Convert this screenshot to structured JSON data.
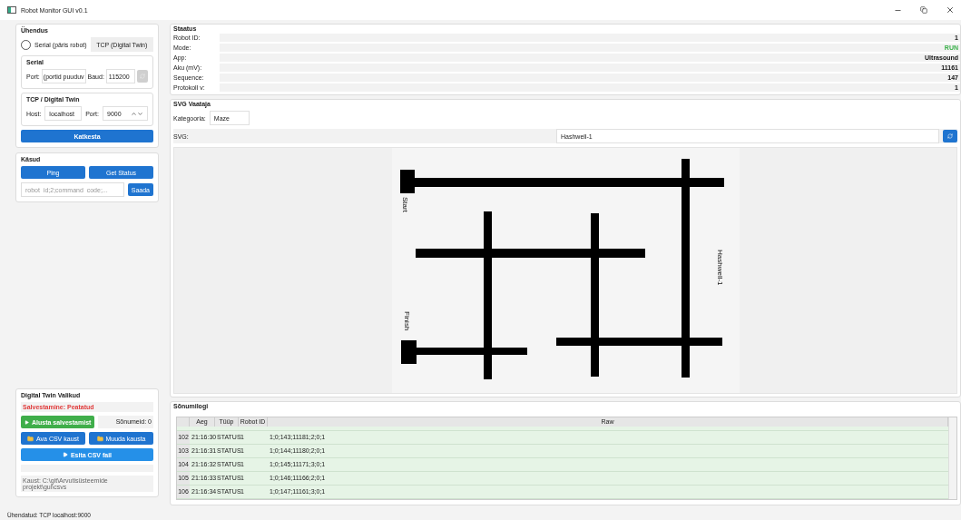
{
  "window": {
    "title": "Robot Monitor GUI v0.1"
  },
  "connection": {
    "title": "Ühendus",
    "modes": [
      {
        "label": "Serial (päris robot)",
        "selected": false
      },
      {
        "label": "TCP (Digital Twin)",
        "selected": true
      }
    ],
    "serial": {
      "title": "Serial",
      "port_label": "Port:",
      "port_value": "(portid puuduv",
      "baud_label": "Baud:",
      "baud_value": "115200",
      "refresh_disabled": true
    },
    "tcp": {
      "title": "TCP / Digital Twin",
      "host_label": "Host:",
      "host_value": "localhost",
      "port_label": "Port:",
      "port_value": "9000"
    },
    "disconnect_button": "Katkesta"
  },
  "commands": {
    "title": "Käsud",
    "buttons": [
      "Ping",
      "Get Status"
    ],
    "input": {
      "placeholder": "robot_id;2;command_code;..."
    },
    "send_button": "Saada"
  },
  "digital_twin": {
    "title": "Digital Twin Valikud",
    "recording_status": "Salvestamine: Peatatud",
    "recording": false,
    "start_button": "Alusta salvestamist",
    "message_count": "Sõnumeid: 0",
    "open_folder_button": "Ava CSV kaust",
    "change_folder_button": "Muuda kausta",
    "play_button": "Esita CSV fail",
    "folder_path": "Kaust: C:\\git\\Arvutisüsteemide projekt\\gui\\csvs"
  },
  "status": {
    "title": "Staatus",
    "rows": [
      {
        "label": "Robot ID:",
        "value": "1",
        "kind": "plain"
      },
      {
        "label": "Mode:",
        "value": "RUN",
        "kind": "ok"
      },
      {
        "label": "App:",
        "value": "Ultrasound",
        "kind": "plain"
      },
      {
        "label": "Aku (mV):",
        "value": "11161",
        "kind": "plain"
      },
      {
        "label": "Sequence:",
        "value": "147",
        "kind": "plain"
      },
      {
        "label": "Protokoll v:",
        "value": "1",
        "kind": "plain"
      }
    ]
  },
  "svg_viewer": {
    "title": "SVG Vaataja",
    "category_label": "Kategooria:",
    "category": "Maze",
    "svg_label": "SVG:",
    "svg_value": "Hashwell-1",
    "maze_labels": {
      "start": "Start",
      "finish": "Finish",
      "name": "Hashwell-1"
    }
  },
  "log": {
    "title": "Sõnumilogi",
    "columns": [
      "Aeg",
      "Tüüp",
      "Robot ID",
      "Raw"
    ],
    "rows": [
      {
        "index": "102",
        "cells": [
          "21:16:30",
          "STATUS",
          "1",
          "1;0;143;11181;2;0;1"
        ]
      },
      {
        "index": "103",
        "cells": [
          "21:16:31",
          "STATUS",
          "1",
          "1;0;144;11180;2;0;1"
        ]
      },
      {
        "index": "104",
        "cells": [
          "21:16:32",
          "STATUS",
          "1",
          "1;0;145;11171;3;0;1"
        ]
      },
      {
        "index": "105",
        "cells": [
          "21:16:33",
          "STATUS",
          "1",
          "1;0;146;11166;2;0;1"
        ]
      },
      {
        "index": "106",
        "cells": [
          "21:16:34",
          "STATUS",
          "1",
          "1;0;147;11161;3;0;1"
        ]
      }
    ]
  },
  "status_bar": "Ühendatud: TCP localhost:9000"
}
